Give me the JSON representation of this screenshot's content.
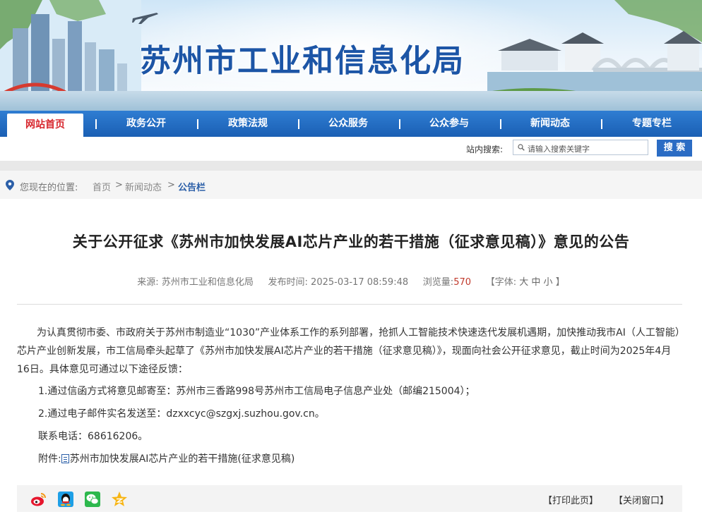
{
  "site": {
    "title": "苏州市工业和信息化局"
  },
  "nav": {
    "items": [
      {
        "label": "网站首页"
      },
      {
        "label": "政务公开"
      },
      {
        "label": "政策法规"
      },
      {
        "label": "公众服务"
      },
      {
        "label": "公众参与"
      },
      {
        "label": "新闻动态"
      },
      {
        "label": "专题专栏"
      }
    ]
  },
  "search": {
    "label": "站内搜索:",
    "placeholder": "请输入搜索关键字",
    "button": "搜 索"
  },
  "breadcrumb": {
    "prefix": "您现在的位置:",
    "home": "首页",
    "sep": ">",
    "news": "新闻动态",
    "current": "公告栏"
  },
  "article": {
    "title": "关于公开征求《苏州市加快发展AI芯片产业的若干措施（征求意见稿）》意见的公告",
    "meta": {
      "source_label": "来源:",
      "source": "苏州市工业和信息化局",
      "time_label": "发布时间:",
      "time": "2025-03-17 08:59:48",
      "views_label": "浏览量:",
      "views": "570",
      "font_open": "【字体:",
      "font_large": "大",
      "font_medium": "中",
      "font_small": "小",
      "font_close": "】"
    },
    "paragraph1": "为认真贯彻市委、市政府关于苏州市制造业“1030”产业体系工作的系列部署，抢抓人工智能技术快速迭代发展机遇期，加快推动我市AI（人工智能）芯片产业创新发展，市工信局牵头起草了《苏州市加快发展AI芯片产业的若干措施（征求意见稿）》，现面向社会公开征求意见，截止时间为2025年4月16日。具体意见可通过以下途径反馈：",
    "item1": "1.通过信函方式将意见邮寄至：苏州市三香路998号苏州市工信局电子信息产业处（邮编215004）；",
    "item2": "2.通过电子邮件实名发送至：dzxxcyc@szgxj.suzhou.gov.cn。",
    "contact": "联系电话：68616206。",
    "attachment_label": "附件:",
    "attachment_name": "苏州市加快发展AI芯片产业的若干措施(征求意见稿)"
  },
  "tools": {
    "print": "【打印此页】",
    "close": "【关闭窗口】",
    "share_icons": [
      "weibo-icon",
      "qq-icon",
      "wechat-icon",
      "qzone-icon"
    ]
  },
  "colors": {
    "nav_blue": "#1a5fb4",
    "title_blue": "#1c55a6",
    "active_red": "#d7262d",
    "views_red": "#c0392b"
  }
}
